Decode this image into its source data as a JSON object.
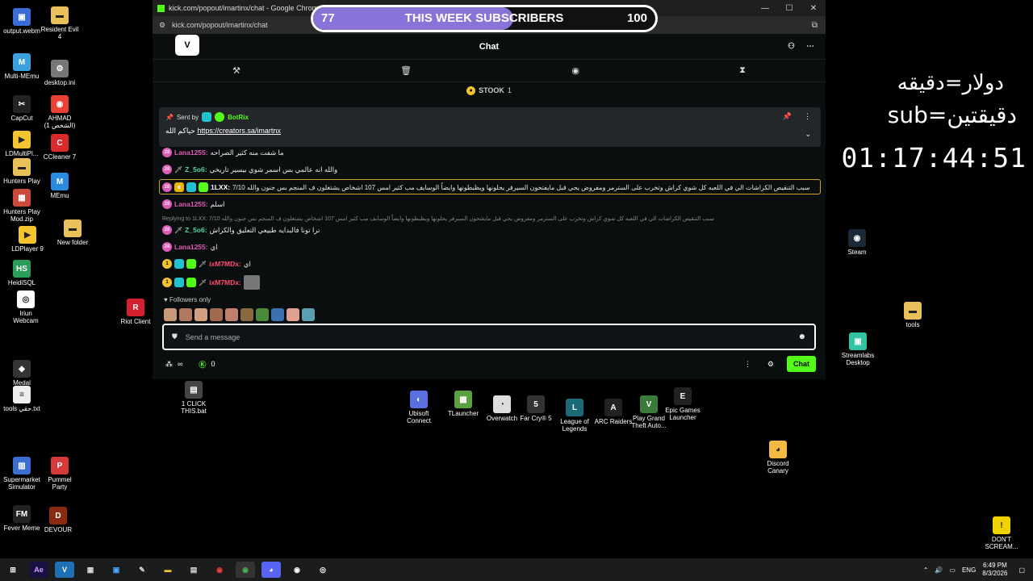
{
  "desktop_left": [
    {
      "label": "output.webm",
      "icon": "file-icon",
      "color": "#3b6bd6",
      "glyph": "▣"
    },
    {
      "label": "Resident Evil\n4",
      "icon": "folder-icon",
      "color": "#e8c15a",
      "glyph": "▬"
    },
    {
      "label": "Multi-MEmu",
      "icon": "multi-memu-icon",
      "color": "#3aa0e0",
      "glyph": "M"
    },
    {
      "label": "desktop.ini",
      "icon": "settings-file-icon",
      "color": "#777",
      "glyph": "⚙"
    },
    {
      "label": "CapCut",
      "icon": "capcut-icon",
      "color": "#222",
      "glyph": "✂"
    },
    {
      "label": "AHMAD\n(الشخص 1)",
      "icon": "chrome-icon",
      "color": "#e94235",
      "glyph": "◉"
    },
    {
      "label": "LDMultiPl...",
      "icon": "ldmultiplayer-icon",
      "color": "#f4c430",
      "glyph": "▶"
    },
    {
      "label": "CCleaner 7",
      "icon": "ccleaner-icon",
      "color": "#d92b2b",
      "glyph": "C"
    },
    {
      "label": "Hunters Play",
      "icon": "folder-icon",
      "color": "#e8c15a",
      "glyph": "▬"
    },
    {
      "label": "MEmu",
      "icon": "memu-icon",
      "color": "#2b8be0",
      "glyph": "M"
    },
    {
      "label": "Hunters Play\nMod.zip",
      "icon": "zip-icon",
      "color": "#c94a3a",
      "glyph": "▦"
    },
    {
      "label": "New folder",
      "icon": "folder-icon",
      "color": "#e8c15a",
      "glyph": "▬"
    },
    {
      "label": "LDPlayer 9",
      "icon": "ldplayer-icon",
      "color": "#f4c430",
      "glyph": "▶"
    },
    {
      "label": "HeidiSQL",
      "icon": "heidisql-icon",
      "color": "#2a9d5a",
      "glyph": "HS"
    },
    {
      "label": "Iriun\nWebcam",
      "icon": "webcam-icon",
      "color": "#fff",
      "glyph": "◎"
    },
    {
      "label": "Riot Client",
      "icon": "riot-icon",
      "color": "#d6202f",
      "glyph": "R"
    },
    {
      "label": "Medal",
      "icon": "medal-icon",
      "color": "#333",
      "glyph": "◆"
    },
    {
      "label": "tools حقي.txt",
      "icon": "text-file-icon",
      "color": "#eee",
      "glyph": "≡"
    },
    {
      "label": "Supermarket\nSimulator",
      "icon": "supermarket-icon",
      "color": "#3a6fd0",
      "glyph": "▥"
    },
    {
      "label": "Pummel\nParty",
      "icon": "pummel-party-icon",
      "color": "#d63a3a",
      "glyph": "P"
    },
    {
      "label": "Fever Meme",
      "icon": "fever-meme-icon",
      "color": "#222",
      "glyph": "FM"
    },
    {
      "label": "DEVOUR",
      "icon": "devour-icon",
      "color": "#8a2a10",
      "glyph": "D"
    }
  ],
  "desktop_mid": [
    {
      "label": "1 CLICK\nTHIS.bat",
      "icon": "bat-file-icon",
      "color": "#444",
      "glyph": "▤"
    },
    {
      "label": "Ubisoft\nConnect",
      "icon": "ubisoft-icon",
      "color": "#5a6fe0",
      "glyph": "◐"
    },
    {
      "label": "TLauncher",
      "icon": "tlauncher-icon",
      "color": "#5aa040",
      "glyph": "▦"
    },
    {
      "label": "Overwatch",
      "icon": "overwatch-icon",
      "color": "#ddd",
      "glyph": "◔"
    },
    {
      "label": "Far Cry® 5",
      "icon": "farcry-icon",
      "color": "#333",
      "glyph": "5"
    },
    {
      "label": "League of\nLegends",
      "icon": "league-icon",
      "color": "#1a6a7a",
      "glyph": "L"
    },
    {
      "label": "ARC Raiders",
      "icon": "arc-raiders-icon",
      "color": "#222",
      "glyph": "A"
    },
    {
      "label": "Play Grand\nTheft Auto...",
      "icon": "gta-icon",
      "color": "#3a7a3a",
      "glyph": "V"
    },
    {
      "label": "Epic Games\nLauncher",
      "icon": "epic-icon",
      "color": "#222",
      "glyph": "E"
    },
    {
      "label": "Discord\nCanary",
      "icon": "discord-canary-icon",
      "color": "#f4b942",
      "glyph": "◕"
    }
  ],
  "desktop_right": [
    {
      "label": "Steam",
      "icon": "steam-icon",
      "color": "#1b2838",
      "glyph": "◉"
    },
    {
      "label": "tools",
      "icon": "folder-icon",
      "color": "#e8c15a",
      "glyph": "▬"
    },
    {
      "label": "Streamlabs\nDesktop",
      "icon": "streamlabs-icon",
      "color": "#31c3a2",
      "glyph": "▣"
    },
    {
      "label": "DON'T\nSCREAM...",
      "icon": "dont-scream-icon",
      "color": "#f2d100",
      "glyph": "!"
    }
  ],
  "browser": {
    "title": "kick.com/popout/imartinx/chat - Google Chrome",
    "url": "kick.com/popout/imartinx/chat",
    "minimize": "—",
    "maximize": "☐",
    "close": "✕"
  },
  "chat": {
    "header_title": "Chat",
    "logo": "V",
    "goal_label": "STOOK",
    "goal_count": "1",
    "pinned": {
      "sent_by": "Sent by",
      "bot_name": "BotRix",
      "message_prefix": "حياكم الله",
      "link": "https://creators.sa/imartnx"
    },
    "messages": [
      {
        "user": "Lana1255:",
        "text": "ما شفت منه كثير الصراحه",
        "color": "#e05ab8"
      },
      {
        "user": "Z_5o6:",
        "text": "والله انه عالمي بس اسمر شوي بيسير تاريخي",
        "color": "#53d4a8"
      },
      {
        "user": "1LXX:",
        "text": "سبب التنقيص الكراشات الي في اللعبه كل شوي كراش وتخرب على السترمر ومفروض يحي قبل مايفتحون السيرفر يحلونها ويظبطونها وايضاً الوسايف مب كثير امس 107 اشخاص يشتغلون ف المنجم بس جنون والله 7/10",
        "color": "#fff"
      },
      {
        "user": "Lana1255:",
        "text": "اسلم",
        "color": "#e05ab8"
      },
      {
        "user": "Z_5o6:",
        "text": "ترا تونا فالبدايه طبيعي التعليق والكراش",
        "color": "#53d4a8"
      },
      {
        "user": "Lana1255:",
        "text": "اي",
        "color": "#e05ab8"
      },
      {
        "user": "ixM7MDx:",
        "text": "اي",
        "color": "#ff4d6d"
      },
      {
        "user": "ixM7MDx:",
        "text": "",
        "color": "#ff4d6d"
      }
    ],
    "reply_text": "Replying to 1LXX: 7/10 سبب التنقيص الكراشات الي في اللعبه كل شوي كراش وتخرب على السترمر ومفروض يحي قبل مايفتحون السيرفر يحلونها ويظبطونها وايضاً الوسايف مب كثير امس 107 اشخاص يشتغلون ف المنجم بس جنون والله",
    "followers_only": "Followers only",
    "input_placeholder": "Send a message",
    "points": "∞",
    "balance": "0",
    "chat_button": "Chat"
  },
  "overlay": {
    "subs_current": "77",
    "subs_label": "THIS WEEK SUBSCRIBERS",
    "subs_goal": "100",
    "subs_progress": 0.77,
    "subs_fill_color": "#8a73d8",
    "rule1": "دولار=دقيقه",
    "rule2": "sub=دقيقتين",
    "timer": "01:17:44:51"
  },
  "taskbar": {
    "apps": [
      {
        "name": "windows-start-icon",
        "glyph": "⊞",
        "color": "#fff",
        "bg": "transparent"
      },
      {
        "name": "after-effects-icon",
        "glyph": "Ae",
        "color": "#d4a0ff",
        "bg": "#1a1040"
      },
      {
        "name": "visual-studio-icon",
        "glyph": "V",
        "color": "#fff",
        "bg": "#1f6fb5"
      },
      {
        "name": "calculator-icon",
        "glyph": "▦",
        "color": "#ddd",
        "bg": "transparent"
      },
      {
        "name": "store-icon",
        "glyph": "▣",
        "color": "#4aa8ff",
        "bg": "transparent"
      },
      {
        "name": "tool-icon",
        "glyph": "✎",
        "color": "#ddd",
        "bg": "transparent"
      },
      {
        "name": "file-explorer-icon",
        "glyph": "▬",
        "color": "#f4c430",
        "bg": "transparent"
      },
      {
        "name": "store-bag-icon",
        "glyph": "▤",
        "color": "#ddd",
        "bg": "transparent"
      },
      {
        "name": "chrome-icon",
        "glyph": "◉",
        "color": "#e94235",
        "bg": "transparent"
      },
      {
        "name": "chrome-active-icon",
        "glyph": "◉",
        "color": "#4caf50",
        "bg": "#333"
      },
      {
        "name": "discord-icon",
        "glyph": "◕",
        "color": "#fff",
        "bg": "#5865f2"
      },
      {
        "name": "steam-taskbar-icon",
        "glyph": "◉",
        "color": "#fff",
        "bg": "transparent"
      },
      {
        "name": "obs-icon",
        "glyph": "◎",
        "color": "#fff",
        "bg": "transparent"
      }
    ],
    "language": "ENG",
    "time": "6:49 PM",
    "date": "8/3/2026"
  }
}
